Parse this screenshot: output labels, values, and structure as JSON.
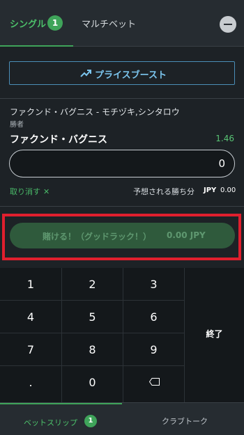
{
  "tabs": {
    "single_label": "シングル",
    "single_count": "1",
    "multi_label": "マルチベット"
  },
  "boost": {
    "label": "プライスブースト",
    "icon": "trending-up-icon"
  },
  "selection": {
    "match": "ファクンド・バグニス - モチヅキ,シンタロウ",
    "market": "勝者",
    "name": "ファクンド・バグニス",
    "odds": "1.46",
    "stake_value": "0"
  },
  "actions": {
    "remove_label": "取り消す",
    "remove_icon": "✕",
    "winnings_label": "予想される勝ち分",
    "winnings_currency": "JPY",
    "winnings_value": "0.00"
  },
  "place_bet": {
    "label": "賭ける！（グッドラック！）",
    "amount": "0.00 JPY"
  },
  "keypad": {
    "keys": [
      "1",
      "2",
      "3",
      "4",
      "5",
      "6",
      "7",
      "8",
      "9",
      ".",
      "0"
    ],
    "done_label": "終了",
    "backspace_icon": "backspace-icon"
  },
  "bottom_nav": {
    "betslip_label": "ベットスリップ",
    "betslip_count": "1",
    "club_label": "クラブトーク"
  },
  "colors": {
    "accent_green": "#3fa45a",
    "boost_blue": "#7cc6ef",
    "highlight_red": "#e01f2e",
    "background": "#1d2226"
  }
}
